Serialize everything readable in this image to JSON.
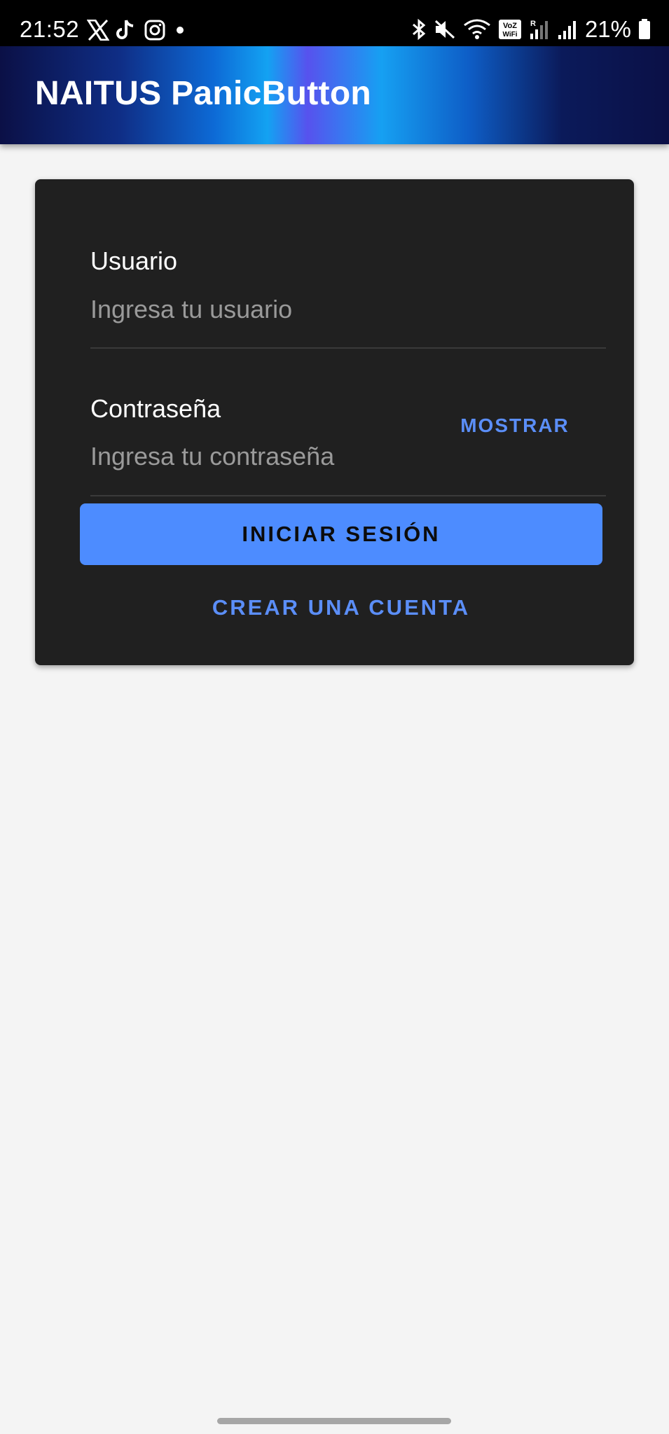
{
  "status_bar": {
    "time": "21:52",
    "left_icons": [
      "x-icon",
      "tiktok-icon",
      "instagram-icon",
      "notification-dot-icon"
    ],
    "right_icons": [
      "bluetooth-icon",
      "mute-icon",
      "wifi-icon",
      "vowifi-icon",
      "signal-roaming-icon",
      "signal-icon",
      "battery-icon"
    ],
    "vowifi_label": "VoZ WiFi",
    "roaming_label": "R",
    "battery_percent": "21%"
  },
  "app_bar": {
    "title": "NAITUS PanicButton"
  },
  "login_form": {
    "username": {
      "label": "Usuario",
      "placeholder": "Ingresa tu usuario",
      "value": ""
    },
    "password": {
      "label": "Contraseña",
      "placeholder": "Ingresa tu contraseña",
      "value": "",
      "toggle_label": "MOSTRAR"
    },
    "submit_label": "INICIAR SESIÓN",
    "create_account_label": "CREAR UNA CUENTA"
  },
  "colors": {
    "accent": "#4d8cff",
    "link": "#5b8ef7",
    "card_background": "#202020",
    "page_background": "#f4f4f4",
    "status_bar": "#000000"
  }
}
